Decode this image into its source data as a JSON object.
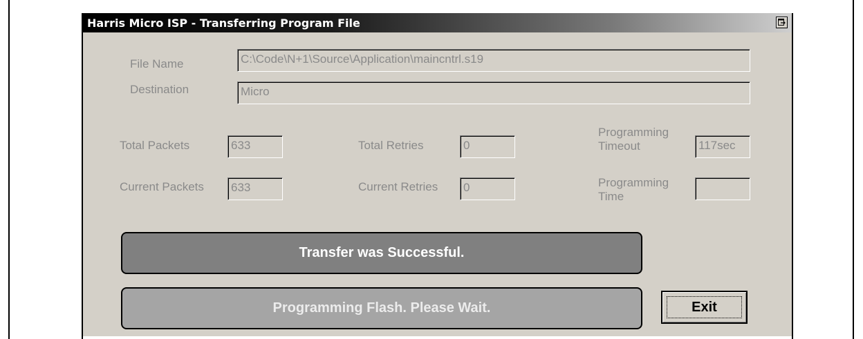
{
  "window": {
    "title": "Harris Micro ISP - Transferring Program File",
    "restore_icon": "restore-window-icon"
  },
  "file": {
    "name_label": "File Name",
    "name_value": "C:\\Code\\N+1\\Source\\Application\\maincntrl.s19",
    "dest_label": "Destination",
    "dest_value": "Micro"
  },
  "stats": {
    "total_packets_label": "Total Packets",
    "total_packets_value": "633",
    "current_packets_label": "Current Packets",
    "current_packets_value": "633",
    "total_retries_label": "Total Retries",
    "total_retries_value": "0",
    "current_retries_label": "Current Retries",
    "current_retries_value": "0",
    "prog_timeout_label_1": "Programming",
    "prog_timeout_label_2": "Timeout",
    "prog_timeout_value": "117sec",
    "prog_time_label_1": "Programming",
    "prog_time_label_2": "Time",
    "prog_time_value": ""
  },
  "status": {
    "success": "Transfer was Successful.",
    "flash": "Programming Flash. Please Wait."
  },
  "buttons": {
    "exit_label": "Exit"
  },
  "colors": {
    "dialog_bg": "#d4d0c8",
    "success_banner": "#808080",
    "flash_banner": "#a5a5a5",
    "disabled_text": "#8a8a8a"
  }
}
